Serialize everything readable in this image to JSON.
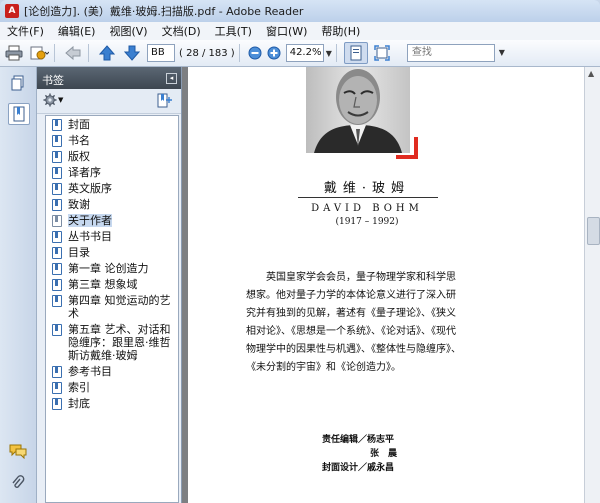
{
  "window": {
    "title": "[论创造力]. (美）戴维·玻姆.扫描版.pdf - Adobe Reader",
    "app_icon": "adobe-reader-icon"
  },
  "menu": {
    "items": [
      "文件(F)",
      "编辑(E)",
      "视图(V)",
      "文档(D)",
      "工具(T)",
      "窗口(W)",
      "帮助(H)"
    ]
  },
  "toolbar": {
    "page_label": "BB",
    "page_count": "( 28 / 183 )",
    "zoom": "42.2%",
    "search_placeholder": "查找"
  },
  "bookmarks": {
    "header": "书签",
    "items": [
      {
        "label": "封面",
        "selected": false
      },
      {
        "label": "书名",
        "selected": false
      },
      {
        "label": "版权",
        "selected": false
      },
      {
        "label": "译者序",
        "selected": false
      },
      {
        "label": "英文版序",
        "selected": false
      },
      {
        "label": "致谢",
        "selected": false
      },
      {
        "label": "关于作者",
        "selected": true
      },
      {
        "label": "丛书书目",
        "selected": false
      },
      {
        "label": "目录",
        "selected": false
      },
      {
        "label": "第一章 论创造力",
        "selected": false
      },
      {
        "label": "第三章 想象域",
        "selected": false
      },
      {
        "label": "第四章 知觉运动的艺术",
        "selected": false
      },
      {
        "label": "第五章 艺术、对话和隐缠序：跟里恩·维哲斯访戴维·玻姆",
        "selected": false
      },
      {
        "label": "参考书目",
        "selected": false
      },
      {
        "label": "索引",
        "selected": false
      },
      {
        "label": "封底",
        "selected": false
      }
    ]
  },
  "document": {
    "author_cn": "戴维·玻姆",
    "author_en": "DAVID BOHM",
    "years": "(1917 – 1992)",
    "bio_lines": [
      "英国皇家学会会员，量子物理学家和科学思",
      "想家。他对量子力学的本体论意义进行了深入研",
      "究并有独到的见解，著述有《量子理论》、《狭义",
      "相对论》、《思想是一个系统》、《论对话》、《现代",
      "物理学中的因果性与机遇》、《整体性与隐缠序》、",
      "《未分割的宇宙》和《论创造力》。"
    ],
    "credits": [
      "责任编辑／杨志平",
      "张　晨",
      "封面设计／戚永昌"
    ]
  },
  "colors": {
    "accent_red": "#e02b20",
    "bookmark_selected": "#c6d8ef",
    "panel_header": "#4a5562"
  }
}
